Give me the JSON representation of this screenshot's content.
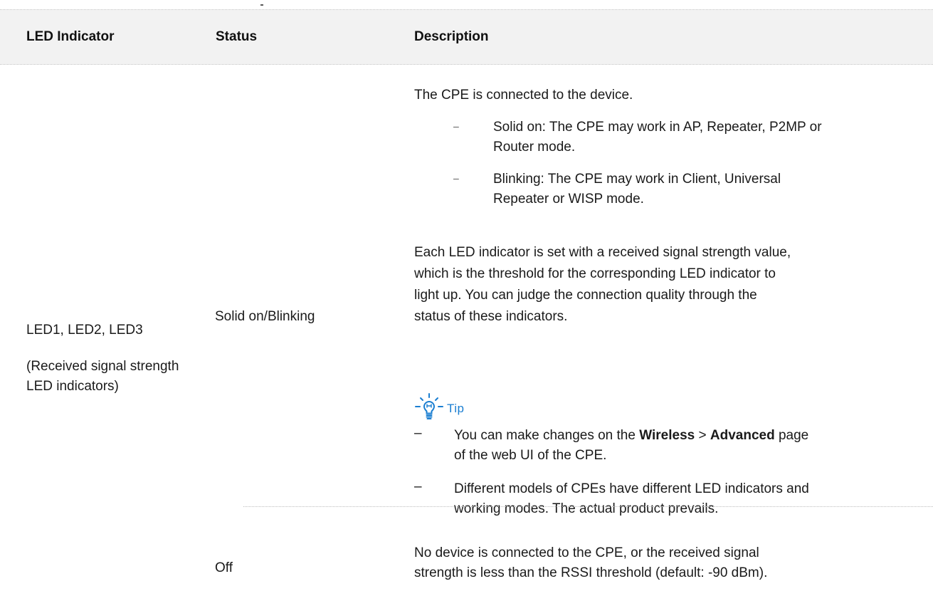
{
  "table": {
    "headers": {
      "led_indicator": "LED Indicator",
      "status": "Status",
      "description": "Description"
    },
    "row": {
      "led": {
        "line1": "LED1, LED2, LED3",
        "line2": "(Received signal strength",
        "line3": "LED indicators)"
      },
      "status_on": "Solid on/Blinking",
      "desc_on": {
        "intro": "The CPE is connected to the device.",
        "bullet1_line1": "Solid on: The CPE may work in AP, Repeater, P2MP or",
        "bullet1_line2": "Router mode.",
        "bullet2_line1": "Blinking: The CPE may work in Client, Universal",
        "bullet2_line2": "Repeater or WISP mode.",
        "para_line1": "Each LED indicator is set with a received signal strength value,",
        "para_line2": "which is the threshold for the corresponding LED indicator to",
        "para_line3": "light up. You can judge the connection quality through the",
        "para_line4": "status of these indicators."
      },
      "tip": {
        "label": "Tip",
        "dash": "–",
        "item1_part1": "You can make changes on the ",
        "item1_bold1": "Wireless",
        "item1_sep": " > ",
        "item1_bold2": "Advanced",
        "item1_part2": " page",
        "item1_line2": "of the web UI of the CPE.",
        "item2_line1": "Different models of CPEs have different LED indicators and",
        "item2_line2": "working modes. The actual product prevails."
      },
      "status_off": "Off",
      "desc_off": {
        "line1": "No device is connected to the CPE, or the received signal",
        "line2": "strength is less than the RSSI threshold (default: -90 dBm)."
      }
    }
  },
  "colors": {
    "header_bg": "#f2f2f2",
    "tip_accent": "#1a7ed1"
  },
  "icons": {
    "tip": "lightbulb-icon",
    "bullet": "short-dash-bullet"
  }
}
